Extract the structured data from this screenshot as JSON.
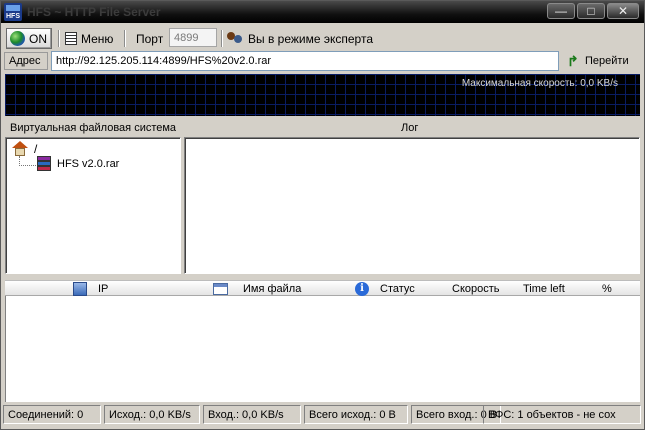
{
  "window": {
    "title": "HFS ~ HTTP File Server",
    "app_icon_text": "HFS",
    "minimize_glyph": "—",
    "maximize_glyph": "□",
    "close_glyph": "✕",
    "icons": {
      "app": "hfs-app-icon",
      "minimize": "minimize-icon",
      "maximize": "maximize-icon",
      "close": "close-icon"
    }
  },
  "toolbar": {
    "on_label": "ON",
    "menu_label": "Меню",
    "port_label": "Порт",
    "port_value": "4899",
    "expert_label": "Вы в режиме эксперта",
    "icons": {
      "on": "globe-icon",
      "menu": "menu-icon",
      "expert": "users-icon"
    }
  },
  "address": {
    "label": "Адрес",
    "value": "http://92.125.205.114:4899/HFS%20v2.0.rar",
    "go_label": "Перейти",
    "go_glyph": "↱",
    "icons": {
      "go": "go-arrow-icon"
    }
  },
  "graph": {
    "max_speed_label": "Максимальная скорость: 0,0 KB/s"
  },
  "vfs": {
    "title": "Виртуальная файловая система",
    "root_label": "/",
    "items": [
      {
        "label": "HFS v2.0.rar",
        "icon": "rar-archive-icon"
      }
    ],
    "icons": {
      "root": "home-icon"
    }
  },
  "log": {
    "title": "Лог"
  },
  "connections": {
    "columns": [
      {
        "label": "IP",
        "icon": "network-icon"
      },
      {
        "label": "Имя файла",
        "icon": "file-icon"
      },
      {
        "label": "Статус",
        "icon": "info-icon"
      },
      {
        "label": "Скорость"
      },
      {
        "label": "Time left"
      },
      {
        "label": "%"
      }
    ],
    "rows": []
  },
  "statusbar": {
    "connections": "Соединений: 0",
    "out_speed": "Исход.: 0,0 KB/s",
    "in_speed": "Вход.: 0,0 KB/s",
    "total_out": "Всего исход.: 0 B",
    "total_in": "Всего вход.: 0 B",
    "vfs_status": "ВФС: 1 объектов - не сох"
  },
  "colors": {
    "window_bg": "#d4d0c8",
    "graph_bg": "#000000",
    "graph_grid": "#0a1d63",
    "titlebar": "#111111"
  }
}
